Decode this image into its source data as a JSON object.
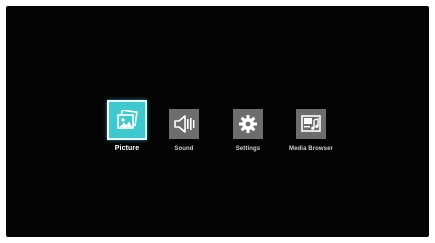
{
  "main_menu": {
    "items": [
      {
        "label": "Picture",
        "icon": "picture-icon",
        "selected": true
      },
      {
        "label": "Sound",
        "icon": "speaker-icon",
        "selected": false
      },
      {
        "label": "Settings",
        "icon": "gear-icon",
        "selected": false
      },
      {
        "label": "Media Browser",
        "icon": "media-browser-icon",
        "selected": false
      }
    ]
  },
  "colors": {
    "screen_background": "#040404",
    "selected_tile": "#3fc9cf",
    "tile": "#6d6d6d",
    "label": "#d0d0d0"
  }
}
